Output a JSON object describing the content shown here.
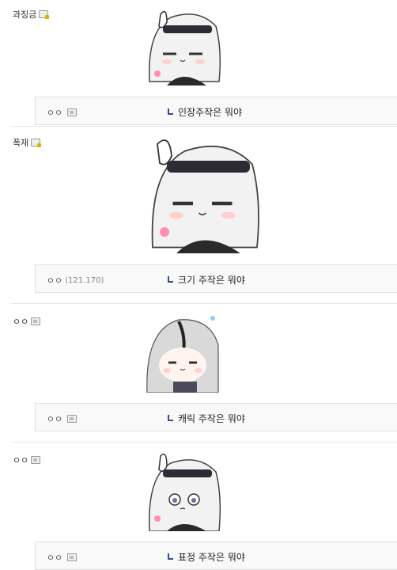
{
  "posts": [
    {
      "nick": "과징금",
      "badge_icon": "lock-badge-icon",
      "reply": {
        "nick": "ㅇㅇ",
        "ip": "",
        "text": "인장주작은 뭐야"
      }
    },
    {
      "nick": "폭재",
      "badge_icon": "lock-badge-icon",
      "reply": {
        "nick": "ㅇㅇ",
        "ip": "(121.170)",
        "text": "크기 주작은 뭐야"
      }
    },
    {
      "nick": "ㅇㅇ",
      "badge_icon": "user-badge-icon",
      "reply": {
        "nick": "ㅇㅇ",
        "ip": "",
        "text": "캐릭 주작은 뭐야"
      }
    },
    {
      "nick": "ㅇㅇ",
      "badge_icon": "user-badge-icon",
      "reply": {
        "nick": "ㅇㅇ",
        "ip": "",
        "text": "표정 주작은 뭐야"
      }
    }
  ],
  "colors": {
    "reply_bg": "#f9f9f9",
    "reply_border": "#e1e1e1",
    "arrow": "#3b4a8a"
  }
}
